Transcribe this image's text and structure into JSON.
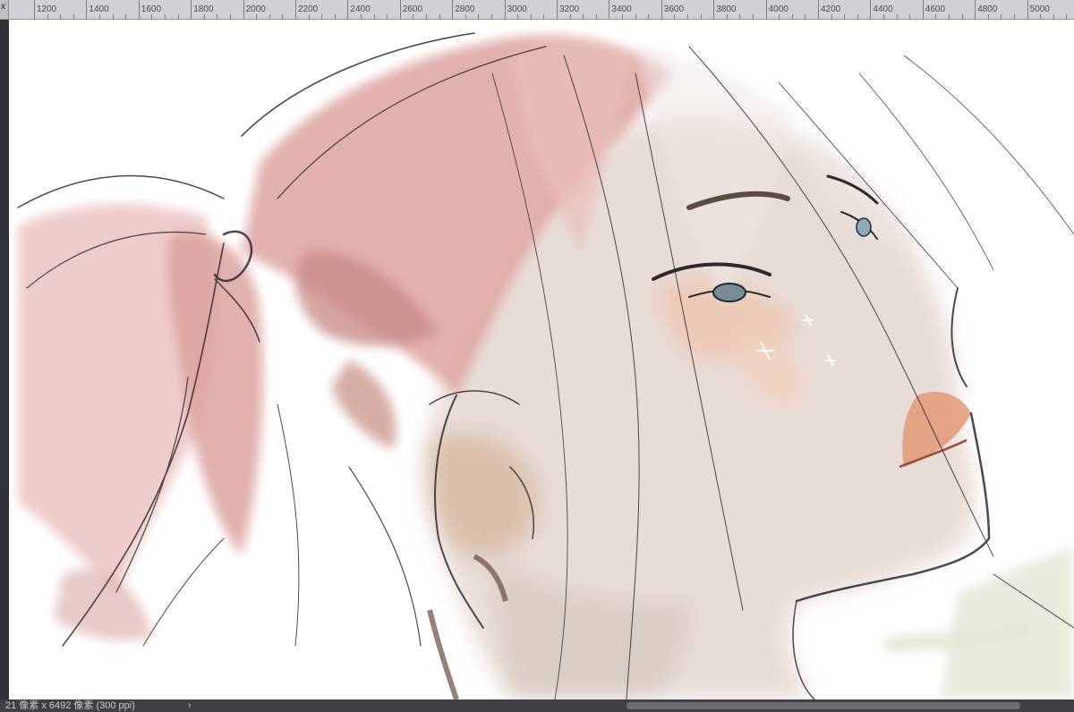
{
  "ruler": {
    "corner_label": "x",
    "units": [
      "1200",
      "1400",
      "1600",
      "1800",
      "2000",
      "2200",
      "2400",
      "2600",
      "2800",
      "3000",
      "3200",
      "3400",
      "3600",
      "3800",
      "4000",
      "4200",
      "4400",
      "4600",
      "4800",
      "5000"
    ]
  },
  "canvas": {
    "subject": "digital painting sketch — portrait with pink hair"
  },
  "statusbar": {
    "document_info": "21 像素 x 6492 像素 (300 ppi)",
    "arrow": "›"
  },
  "colors": {
    "ruler_bg": "#cfd1d4",
    "hair_pink": "#d99a98",
    "skin": "#e6d6cf",
    "line": "#2e2a2c",
    "lip": "#d9865f"
  }
}
